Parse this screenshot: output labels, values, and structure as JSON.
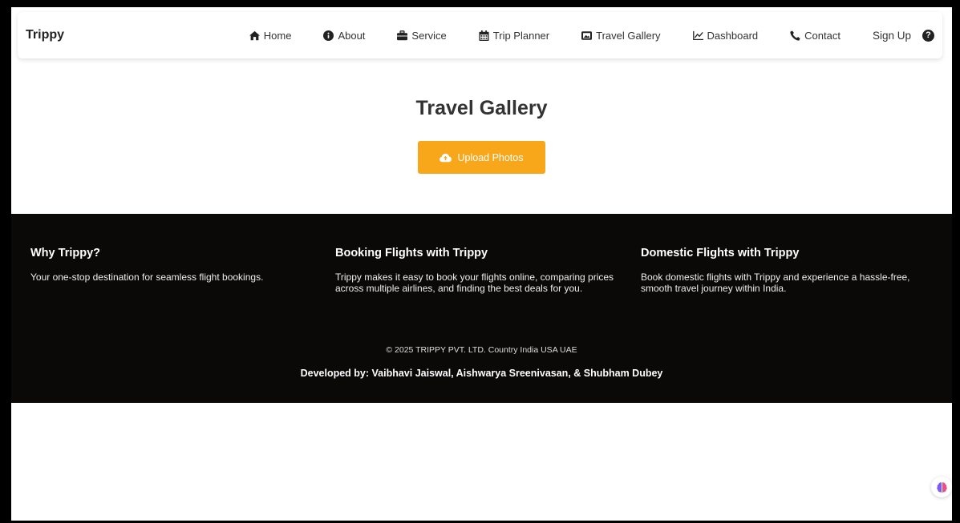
{
  "nav": {
    "brand": "Trippy",
    "links": [
      {
        "label": "Home",
        "icon": "home-icon"
      },
      {
        "label": "About",
        "icon": "info-icon"
      },
      {
        "label": "Service",
        "icon": "briefcase-icon"
      },
      {
        "label": "Trip Planner",
        "icon": "calendar-icon"
      },
      {
        "label": "Travel Gallery",
        "icon": "images-icon"
      },
      {
        "label": "Dashboard",
        "icon": "chart-line-icon"
      },
      {
        "label": "Contact",
        "icon": "phone-icon"
      }
    ],
    "signup": "Sign Up",
    "help": "?"
  },
  "hero": {
    "title": "Travel Gallery",
    "upload_label": "Upload Photos"
  },
  "footer": {
    "columns": [
      {
        "title": "Why Trippy?",
        "text": "Your one-stop destination for seamless flight bookings."
      },
      {
        "title": "Booking Flights with Trippy",
        "text": "Trippy makes it easy to book your flights online, comparing prices across multiple airlines, and finding the best deals for you."
      },
      {
        "title": "Domestic Flights with Trippy",
        "text": "Book domestic flights with Trippy and experience a hassle-free, smooth travel journey within India."
      }
    ],
    "copyright": "© 2025 TRIPPY PVT. LTD. Country India USA UAE",
    "developed": "Developed by: Vaibhavi Jaiswal, Aishwarya Sreenivasan, & Shubham Dubey"
  },
  "colors": {
    "accent": "#f8a61a",
    "footer_bg": "#0b0808"
  }
}
